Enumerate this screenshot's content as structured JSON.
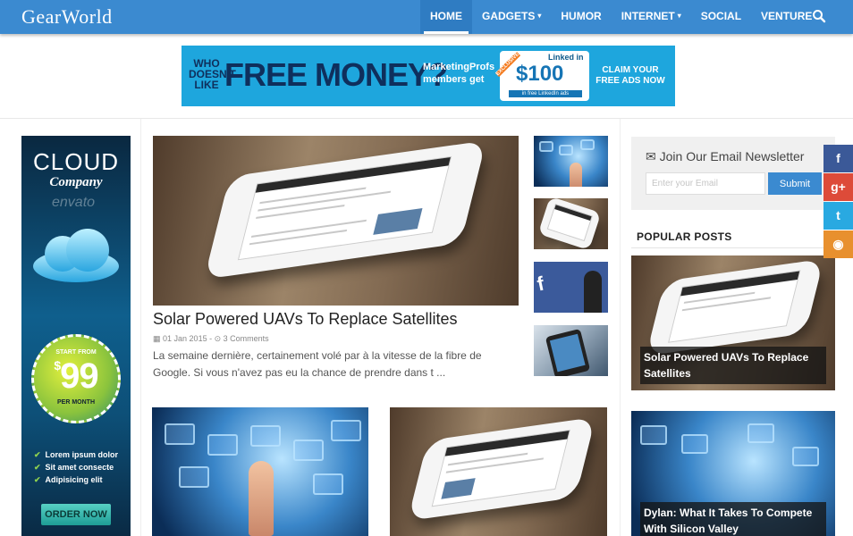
{
  "header": {
    "logo": "GearWorld",
    "nav": [
      {
        "label": "HOME",
        "caret": ""
      },
      {
        "label": "GADGETS",
        "caret": "▾"
      },
      {
        "label": "HUMOR",
        "caret": ""
      },
      {
        "label": "INTERNET",
        "caret": "▾"
      },
      {
        "label": "SOCIAL",
        "caret": ""
      },
      {
        "label": "VENTURE",
        "caret": ""
      }
    ],
    "search_icon": "search-icon"
  },
  "banner": {
    "who": "WHO DOESN'T LIKE",
    "headline": "FREE MONEY?",
    "brand_line": "MarketingProfs members get",
    "exclusive": "EXCLUSIVE",
    "linkedin": "Linked in",
    "amount": "$100",
    "amount_note": "in free LinkedIn ads",
    "cta": "CLAIM YOUR FREE ADS NOW"
  },
  "side_ad": {
    "title": "CLOUD",
    "subtitle": "Company",
    "watermark": "envato",
    "start_from": "START FROM",
    "currency": "$",
    "price": "99",
    "per": "PER MONTH",
    "features": [
      "Lorem ipsum dolor",
      "Sit amet consecte",
      "Adipisicing elit"
    ],
    "order": "ORDER NOW"
  },
  "featured": {
    "title": "Solar Powered UAVs To Replace Satellites",
    "date": "01 Jan 2015",
    "comments": "3 Comments",
    "excerpt": "La semaine dernière, certainement volé par à la vitesse de la fibre de Google. Si vous n'avez pas eu la chance de prendre dans t ..."
  },
  "sidebar": {
    "newsletter_title": "Join Our Email Newsletter",
    "email_placeholder": "Enter your Email",
    "submit": "Submit",
    "popular_heading": "POPULAR POSTS",
    "popular": [
      "Solar Powered UAVs To Replace Satellites",
      "Dylan: What It Takes To Compete With Silicon Valley"
    ]
  },
  "social": [
    {
      "icon": "facebook-icon",
      "glyph": "f",
      "color": "#3b5998"
    },
    {
      "icon": "google-plus-icon",
      "glyph": "g+",
      "color": "#dd4b39"
    },
    {
      "icon": "twitter-icon",
      "glyph": "t",
      "color": "#29a9e1"
    },
    {
      "icon": "rss-icon",
      "glyph": "◉",
      "color": "#e8902e"
    }
  ]
}
